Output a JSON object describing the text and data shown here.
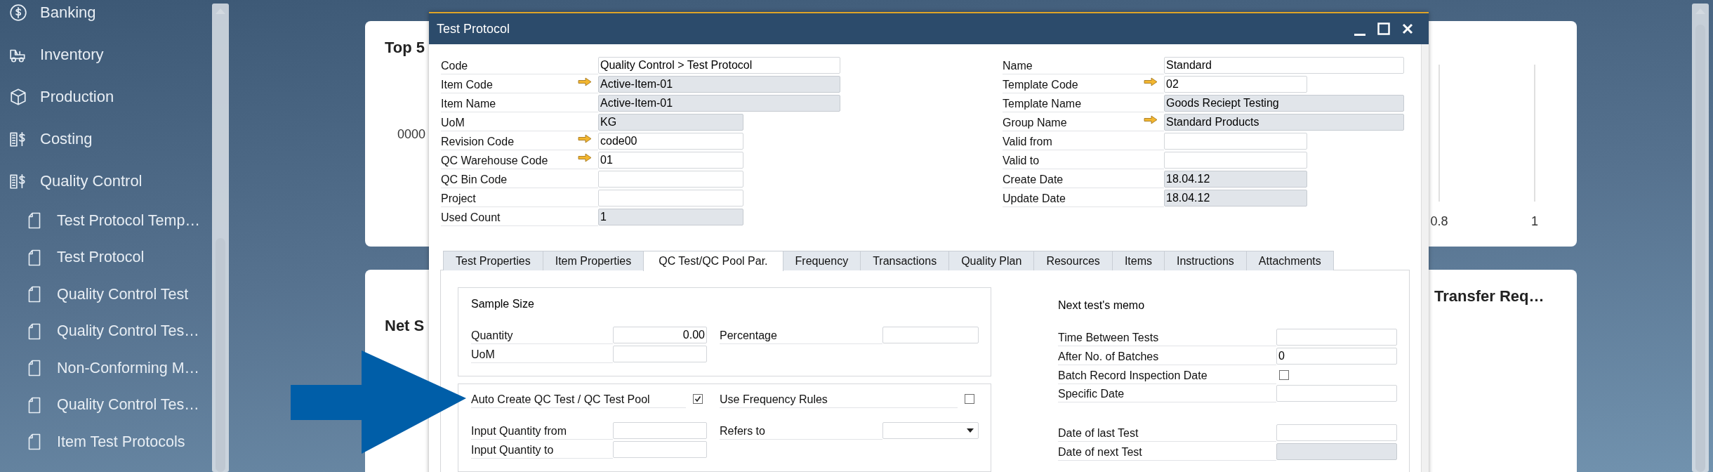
{
  "sidebar": {
    "items": [
      {
        "label": "Banking"
      },
      {
        "label": "Inventory"
      },
      {
        "label": "Production"
      },
      {
        "label": "Costing"
      },
      {
        "label": "Quality Control",
        "children": [
          {
            "label": "Test Protocol Temp…"
          },
          {
            "label": "Test Protocol"
          },
          {
            "label": "Quality Control Test"
          },
          {
            "label": "Quality Control Tes…"
          },
          {
            "label": "Non-Conforming M…"
          },
          {
            "label": "Quality Control Tes…"
          },
          {
            "label": "Item Test Protocols"
          }
        ]
      }
    ]
  },
  "dashboard": {
    "cards": [
      {
        "title": "Top 5",
        "axis_labels": [
          "0000",
          "0.8",
          "1"
        ]
      },
      {
        "title": "Net S"
      },
      {
        "title": "Transfer Req…"
      }
    ]
  },
  "dialog": {
    "title": "Test Protocol",
    "header": {
      "left": [
        {
          "label": "Code",
          "value": "Quality Control > Test Protocol",
          "link_arrow": false,
          "disabled": false
        },
        {
          "label": "Item Code",
          "value": "Active-Item-01",
          "link_arrow": true,
          "disabled": true
        },
        {
          "label": "Item Name",
          "value": "Active-Item-01",
          "link_arrow": false,
          "disabled": true
        },
        {
          "label": "UoM",
          "value": "KG",
          "link_arrow": false,
          "disabled": true
        },
        {
          "label": "Revision Code",
          "value": "code00",
          "link_arrow": true,
          "disabled": false
        },
        {
          "label": "QC Warehouse Code",
          "value": "01",
          "link_arrow": true,
          "disabled": false
        },
        {
          "label": "QC Bin Code",
          "link_arrow": false,
          "disabled": false
        },
        {
          "label": "Project",
          "link_arrow": false,
          "disabled": false
        },
        {
          "label": "Used Count",
          "value": "1",
          "link_arrow": false,
          "disabled": true
        }
      ],
      "right": [
        {
          "label": "Name",
          "value": "Standard",
          "link_arrow": false,
          "disabled": false
        },
        {
          "label": "Template Code",
          "value": "02",
          "link_arrow": true,
          "disabled": false
        },
        {
          "label": "Template Name",
          "value": "Goods Reciept Testing",
          "link_arrow": false,
          "disabled": true
        },
        {
          "label": "Group Name",
          "value": "Standard Products",
          "link_arrow": true,
          "disabled": true
        },
        {
          "label": "Valid from",
          "link_arrow": false,
          "disabled": false
        },
        {
          "label": "Valid to",
          "link_arrow": false,
          "disabled": false
        },
        {
          "label": "Create Date",
          "value": "18.04.12",
          "link_arrow": false,
          "disabled": true
        },
        {
          "label": "Update Date",
          "value": "18.04.12",
          "link_arrow": false,
          "disabled": true
        }
      ]
    },
    "tabs": [
      {
        "label": "Test Properties",
        "selected": false
      },
      {
        "label": "Item Properties",
        "selected": false
      },
      {
        "label": "QC Test/QC Pool Par.",
        "selected": true
      },
      {
        "label": "Frequency",
        "selected": false
      },
      {
        "label": "Transactions",
        "selected": false
      },
      {
        "label": "Quality Plan",
        "selected": false
      },
      {
        "label": "Resources",
        "selected": false
      },
      {
        "label": "Items",
        "selected": false
      },
      {
        "label": "Instructions",
        "selected": false
      },
      {
        "label": "Attachments",
        "selected": false
      }
    ],
    "sample_size": {
      "title": "Sample Size",
      "left": [
        {
          "kind": "field",
          "label": "Quantity",
          "value": "0.00",
          "disabled": false
        },
        {
          "kind": "field",
          "label": "UoM",
          "disabled": false
        }
      ],
      "right": [
        {
          "kind": "field",
          "label": "Percentage",
          "disabled": false
        }
      ]
    },
    "auto_create": {
      "left": [
        {
          "kind": "checkbox",
          "label": "Auto Create QC Test / QC Test Pool",
          "checked": true
        },
        {
          "kind": "field",
          "label": "Input Quantity from",
          "disabled": false
        },
        {
          "kind": "field",
          "label": "Input Quantity to",
          "disabled": false
        }
      ],
      "right": [
        {
          "kind": "checkbox",
          "label": "Use Frequency Rules",
          "checked": false
        },
        {
          "kind": "dropdown",
          "label": "Refers to",
          "disabled": false
        }
      ]
    },
    "memo": {
      "title": "Next test's memo",
      "rows": [
        {
          "kind": "field",
          "label": "Time Between Tests",
          "disabled": false
        },
        {
          "kind": "field",
          "label": "After No. of Batches",
          "value": "0",
          "disabled": false
        },
        {
          "kind": "checkbox",
          "label": "Batch Record Inspection Date",
          "checked": false
        },
        {
          "kind": "field",
          "label": "Specific Date",
          "disabled": false
        }
      ],
      "date_rows": [
        {
          "kind": "field",
          "label": "Date of last Test",
          "disabled": false
        },
        {
          "kind": "field",
          "label": "Date of next Test",
          "disabled": true
        }
      ]
    }
  }
}
